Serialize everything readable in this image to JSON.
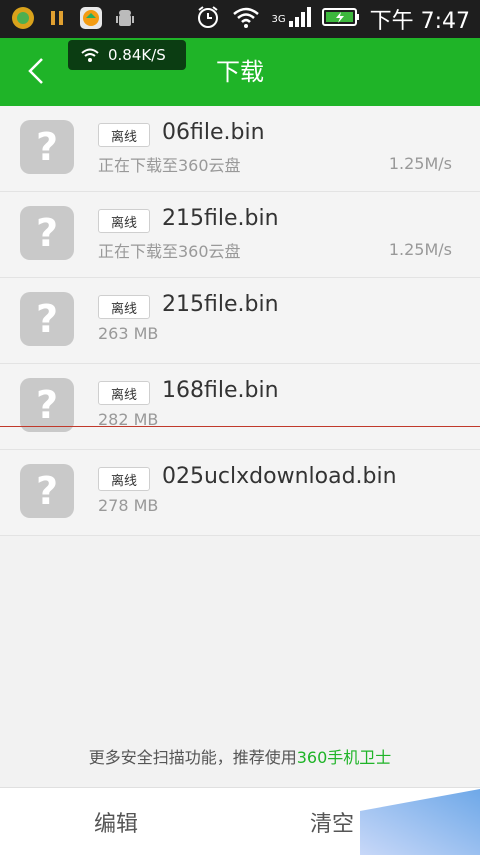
{
  "statusbar": {
    "network": "3G",
    "time": "下午 7:47"
  },
  "header": {
    "title": "下载",
    "speed": "0.84K/S"
  },
  "downloads": [
    {
      "badge": "离线",
      "name": "06file.bin",
      "status": "正在下载至360云盘",
      "speed": "1.25M/s"
    },
    {
      "badge": "离线",
      "name": "215file.bin",
      "status": "正在下载至360云盘",
      "speed": "1.25M/s"
    },
    {
      "badge": "离线",
      "name": "215file.bin",
      "status": "263 MB",
      "speed": ""
    },
    {
      "badge": "离线",
      "name": "168file.bin",
      "status": "282 MB",
      "speed": ""
    },
    {
      "badge": "离线",
      "name": "025uclxdownload.bin",
      "status": "278 MB",
      "speed": ""
    }
  ],
  "footer_note": {
    "text": "更多安全扫描功能，推荐使用",
    "link": "360手机卫士"
  },
  "bottom_bar": {
    "edit": "编辑",
    "clear": "清空"
  },
  "colors": {
    "accent": "#1fb428",
    "statusbar": "#1e1e1e",
    "placeholder": "#c9c9c9"
  }
}
